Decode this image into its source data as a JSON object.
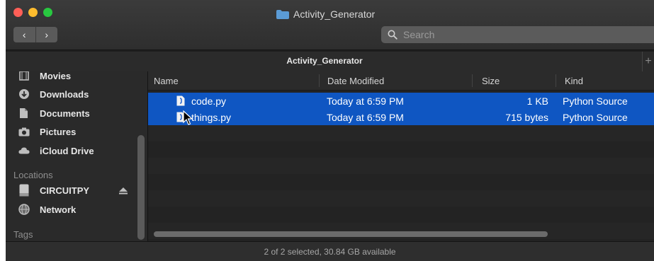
{
  "window": {
    "title": "Activity_Generator"
  },
  "toolbar": {
    "back_label": "‹",
    "forward_label": "›",
    "search_placeholder": "Search"
  },
  "tabbar": {
    "title": "Activity_Generator",
    "plus_label": "+"
  },
  "sidebar": {
    "favorites": [
      {
        "label": "Movies",
        "icon": "film-icon"
      },
      {
        "label": "Downloads",
        "icon": "download-icon"
      },
      {
        "label": "Documents",
        "icon": "documents-icon"
      },
      {
        "label": "Pictures",
        "icon": "camera-icon"
      },
      {
        "label": "iCloud Drive",
        "icon": "cloud-icon"
      }
    ],
    "locations_heading": "Locations",
    "locations": [
      {
        "label": "CIRCUITPY",
        "icon": "drive-icon"
      },
      {
        "label": "Network",
        "icon": "network-icon"
      }
    ],
    "tags_heading": "Tags"
  },
  "list": {
    "columns": [
      "Name",
      "Date Modified",
      "Size",
      "Kind"
    ],
    "files": [
      {
        "name": "code.py",
        "modified": "Today at 6:59 PM",
        "size": "1 KB",
        "kind": "Python Source",
        "selected": true
      },
      {
        "name": "things.py",
        "modified": "Today at 6:59 PM",
        "size": "715 bytes",
        "kind": "Python Source",
        "selected": true
      }
    ]
  },
  "status": {
    "text": "2 of 2 selected, 30.84 GB available"
  },
  "colors": {
    "selection": "#0f56c2",
    "folder": "#5b9bd5"
  }
}
